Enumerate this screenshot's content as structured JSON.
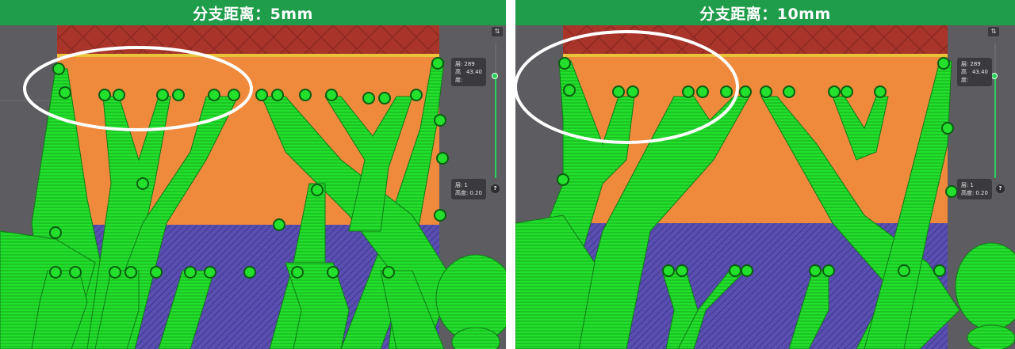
{
  "left": {
    "title": "分支距离：5mm",
    "top_layer": {
      "layer_label": "层:",
      "layer_value": "289",
      "height_label": "高度:",
      "height_value": "43.40"
    },
    "bottom_layer": {
      "layer_label": "层:",
      "layer_value": "1",
      "height_label": "高度:",
      "height_value": "0.20"
    },
    "help": "?",
    "top_icon": "⇅"
  },
  "right": {
    "title": "分支距离：10mm",
    "top_layer": {
      "layer_label": "层:",
      "layer_value": "289",
      "height_label": "高度:",
      "height_value": "43.40"
    },
    "bottom_layer": {
      "layer_label": "层:",
      "layer_value": "1",
      "height_label": "高度:",
      "height_value": "0.20"
    },
    "help": "?",
    "top_icon": "⇅"
  },
  "colors": {
    "title_bar": "#1f9d4a",
    "support_green": "#22e02b",
    "orange_wall": "#ef8a3c",
    "red_top": "#a8342a",
    "purple_base": "#5a4fb0",
    "highlight_ellipse": "#ffffff"
  },
  "icons": [
    "layer-slider-knob",
    "help-icon",
    "view-toggle-icon"
  ]
}
